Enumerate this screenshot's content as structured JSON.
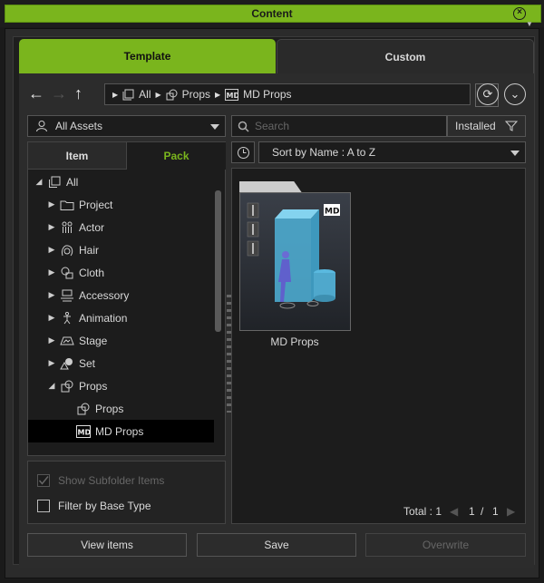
{
  "window": {
    "title": "Content"
  },
  "tabs": [
    {
      "label": "Template",
      "active": true
    },
    {
      "label": "Custom",
      "active": false
    }
  ],
  "breadcrumb": [
    "All",
    "Props",
    "MD Props"
  ],
  "filter": {
    "assets": "All Assets",
    "search_placeholder": "Search",
    "installed": "Installed",
    "sort": "Sort by Name : A to Z"
  },
  "subtabs": [
    "Item",
    "Pack"
  ],
  "tree": [
    {
      "label": "All",
      "expanded": true
    },
    {
      "label": "Project",
      "icon": "folder-icon"
    },
    {
      "label": "Actor",
      "icon": "actor-icon"
    },
    {
      "label": "Hair",
      "icon": "hair-icon"
    },
    {
      "label": "Cloth",
      "icon": "cloth-icon"
    },
    {
      "label": "Accessory",
      "icon": "accessory-icon"
    },
    {
      "label": "Animation",
      "icon": "animation-icon"
    },
    {
      "label": "Stage",
      "icon": "stage-icon"
    },
    {
      "label": "Set",
      "icon": "set-icon"
    },
    {
      "label": "Props",
      "icon": "props-icon",
      "expanded": true
    },
    {
      "label": "Props",
      "icon": "props-icon"
    },
    {
      "label": "MD Props",
      "icon": "md-icon",
      "selected": true
    }
  ],
  "options": {
    "show_subfolder": "Show Subfolder Items",
    "filter_base": "Filter by Base Type"
  },
  "grid": {
    "items": [
      {
        "label": "MD Props",
        "badge": "MD"
      }
    ]
  },
  "pager": {
    "total": "Total : 1",
    "page": "1",
    "sep": "/",
    "pages": "1"
  },
  "buttons": {
    "view": "View items",
    "save": "Save",
    "overwrite": "Overwrite"
  },
  "colors": {
    "accent": "#7ab51d",
    "background": "#2c2c2c"
  }
}
